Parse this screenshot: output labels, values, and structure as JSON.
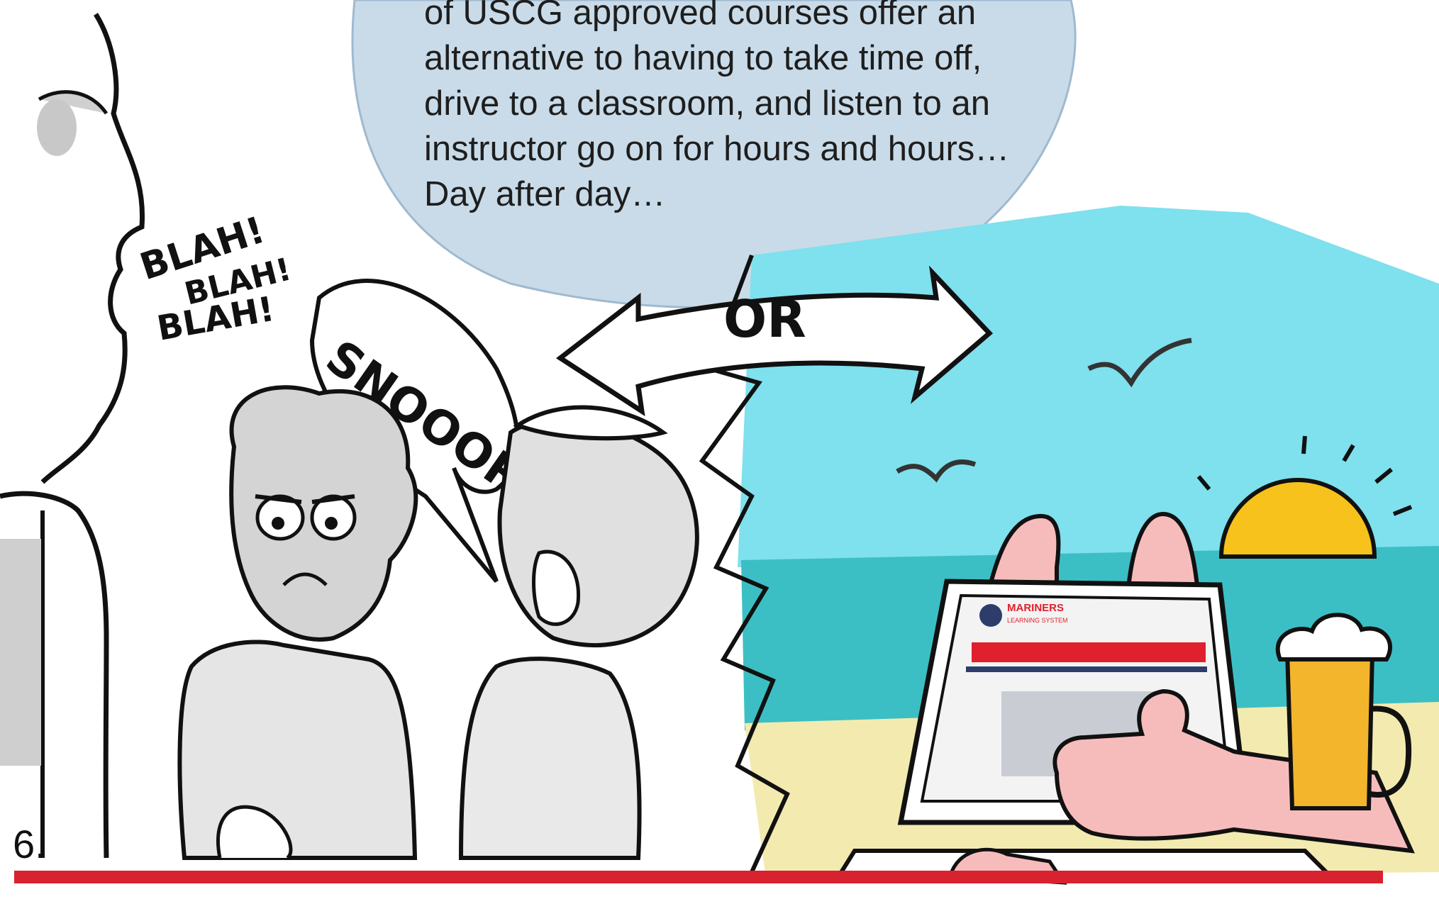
{
  "caption": {
    "lines": [
      "of USCG approved courses offer an",
      "alternative to having to take time off,",
      "drive to a classroom, and listen to an",
      "instructor go on for hours and hours…",
      "Day after day…"
    ]
  },
  "panel_number": "6.",
  "speech": {
    "blah_1": "BLAH!",
    "blah_2": "BLAH!",
    "blah_3": "BLAH!",
    "snore": "SNOOORE",
    "or": "OR"
  },
  "laptop": {
    "logo_line1": "MARINERS",
    "logo_line2": "LEARNING SYSTEM"
  },
  "colors": {
    "bubble": "#c9dbe8",
    "sky": "#7fe0ee",
    "sea": "#3cbfc4",
    "sand": "#f3eab0",
    "sun": "#f7c21c",
    "floor": "#d8222f",
    "skin": "#f6bcbc",
    "beer": "#f2b52b",
    "brand_red": "#e0202c",
    "brand_navy": "#2c3d6b",
    "shading": "#c8c8c8"
  },
  "icons": [
    "seagull-icon",
    "sun-icon",
    "thumbs-up-icon",
    "beer-mug-icon"
  ]
}
